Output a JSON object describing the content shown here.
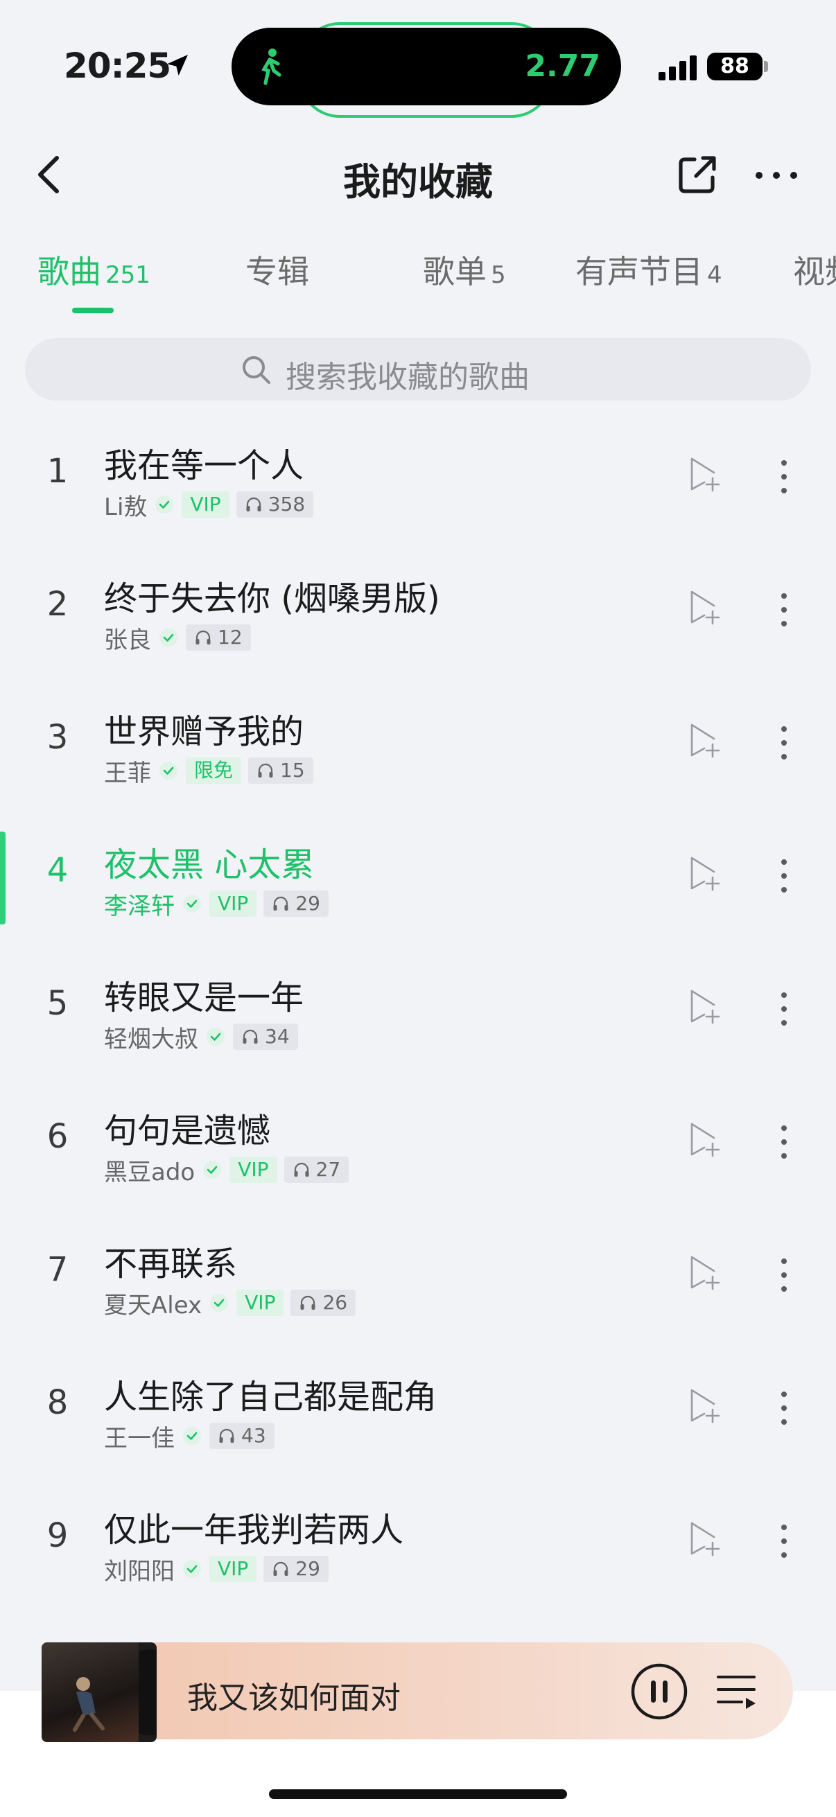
{
  "status_bar": {
    "time": "20:25",
    "activity_value": "2.77",
    "battery": "88"
  },
  "header": {
    "title": "我的收藏"
  },
  "tabs": [
    {
      "label": "歌曲",
      "count": "251"
    },
    {
      "label": "专辑",
      "count": ""
    },
    {
      "label": "歌单",
      "count": "5"
    },
    {
      "label": "有声节目",
      "count": "4"
    },
    {
      "label": "视频",
      "count": ""
    }
  ],
  "search": {
    "placeholder": "搜索我收藏的歌曲"
  },
  "songs": [
    {
      "num": "1",
      "title": "我在等一个人",
      "artist": "Li敖",
      "badge": "VIP",
      "listens": "358"
    },
    {
      "num": "2",
      "title": "终于失去你 (烟嗓男版)",
      "artist": "张良",
      "badge": "",
      "listens": "12"
    },
    {
      "num": "3",
      "title": "世界赠予我的",
      "artist": "王菲",
      "badge": "限免",
      "listens": "15"
    },
    {
      "num": "4",
      "title": "夜太黑 心太累",
      "artist": "李泽轩",
      "badge": "VIP",
      "listens": "29"
    },
    {
      "num": "5",
      "title": "转眼又是一年",
      "artist": "轻烟大叔",
      "badge": "",
      "listens": "34"
    },
    {
      "num": "6",
      "title": "句句是遗憾",
      "artist": "黑豆ado",
      "badge": "VIP",
      "listens": "27"
    },
    {
      "num": "7",
      "title": "不再联系",
      "artist": "夏天Alex",
      "badge": "VIP",
      "listens": "26"
    },
    {
      "num": "8",
      "title": "人生除了自己都是配角",
      "artist": "王一佳",
      "badge": "",
      "listens": "43"
    },
    {
      "num": "9",
      "title": "仅此一年我判若两人",
      "artist": "刘阳阳",
      "badge": "VIP",
      "listens": "29"
    }
  ],
  "now_playing": {
    "title": "我又该如何面对",
    "playing_index": 4
  },
  "colors": {
    "accent": "#1ec16a",
    "background": "#f1f3f7"
  }
}
